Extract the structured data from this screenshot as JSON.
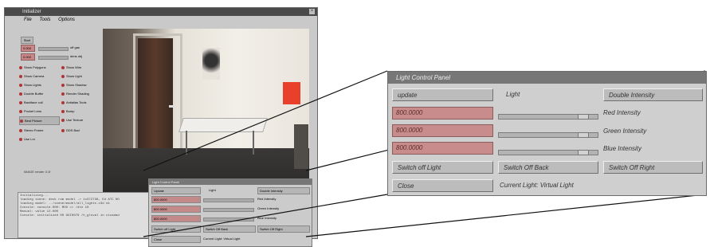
{
  "main_window": {
    "title": "Initializer",
    "menu": [
      "File",
      "Tools",
      "Options"
    ],
    "left_panel": {
      "start_button": "Start",
      "fields": [
        "0.000",
        "0.000"
      ],
      "slider_labels": [
        "off gas",
        "dens obj"
      ],
      "options": [
        {
          "label": "Show Polygons",
          "boxed": false
        },
        {
          "label": "Show Wire",
          "boxed": false
        },
        {
          "label": "Show Camera",
          "boxed": false
        },
        {
          "label": "Show Light",
          "boxed": false
        },
        {
          "label": "Show Lights",
          "boxed": false
        },
        {
          "label": "Show Shadow",
          "boxed": false
        },
        {
          "label": "Double Buffer",
          "boxed": false
        },
        {
          "label": "Render Shading",
          "boxed": false
        },
        {
          "label": "Backface cull",
          "boxed": false
        },
        {
          "label": "Antialias Tools",
          "boxed": false
        },
        {
          "label": "Pocket Lens",
          "boxed": false
        },
        {
          "label": "Bump",
          "boxed": false
        },
        {
          "label": "Best Picture",
          "boxed": true
        },
        {
          "label": "Use Texture",
          "boxed": false
        },
        {
          "label": "Stereo Frame",
          "boxed": false
        },
        {
          "label": "DDS Bad",
          "boxed": false
        },
        {
          "label": "Use Lm",
          "boxed": false
        }
      ],
      "status": "IMAGE render 3:1f"
    },
    "console_lines": [
      "Initializing...",
      "loading scene: desk rom model -> 1x372738, Ed ATC NO",
      "loading model: ../scene/model/all_lights.x3d ok",
      "Console: console.000: MOO <> /dtn 10",
      "Manual: value 12.000",
      "Console: initialized 00 GUI0079 /h_gloval in cicadad"
    ]
  },
  "mini_panel": {
    "title": "Light Control Panel",
    "update": "Update",
    "light": "Light",
    "double": "Double Intensity",
    "fields": [
      "800.0000",
      "800.0000",
      "800.0000"
    ],
    "labels": [
      "Red Intensity",
      "Green Intensity",
      "Blue Intensity"
    ],
    "switch_light": "Switch off Light",
    "switch_back": "Switch Off Back",
    "switch_right": "Switch Off Right",
    "close": "Close",
    "current": "Current Light: Virtual Light"
  },
  "light_control_panel": {
    "title": "Light Control Panel",
    "update_button": "update",
    "light_label": "Light",
    "double_intensity_button": "Double Intensity",
    "intensity_rows": [
      {
        "value": "800.0000",
        "label": "Red Intensity",
        "slider_level": 0.9
      },
      {
        "value": "800.0000",
        "label": "Green Intensity",
        "slider_level": 0.9
      },
      {
        "value": "800.0000",
        "label": "Blue Intensity",
        "slider_level": 0.9
      }
    ],
    "switch_off_light_button": "Switch off Light",
    "switch_off_back_button": "Switch Off Back",
    "switch_off_right_button": "Switch Off Right",
    "close_button": "Close",
    "current_light_text": "Current Light: Virtual Light"
  }
}
